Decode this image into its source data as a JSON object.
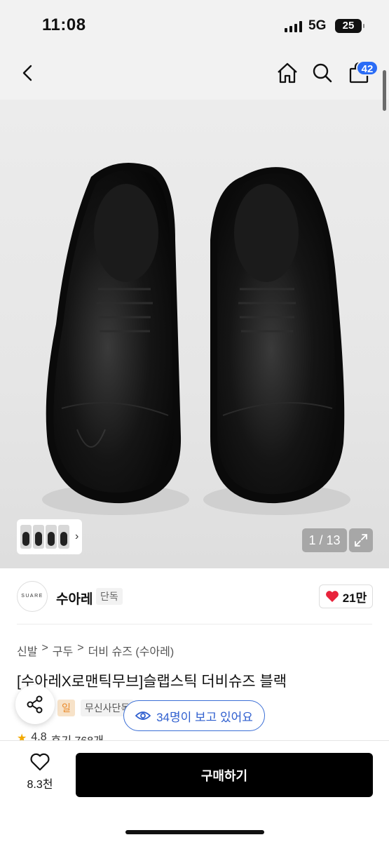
{
  "status_bar": {
    "time": "11:08",
    "network": "5G",
    "battery": "25",
    "icons": [
      "signal-icon",
      "battery-icon"
    ]
  },
  "nav": {
    "icons": [
      "back-icon",
      "home-icon",
      "search-icon",
      "cart-icon"
    ],
    "cart_badge": "42"
  },
  "gallery": {
    "counter": "1 / 13",
    "thumb_arrow": "›",
    "icons": [
      "expand-icon",
      "chevron-right-icon"
    ]
  },
  "brand": {
    "logo_text": "SUARE",
    "name": "수아레",
    "tag": "단독",
    "likes": "21만",
    "icons": [
      "heart-icon"
    ]
  },
  "breadcrumb": {
    "items": [
      "신발",
      "구두",
      "더비 슈즈 (수아레)"
    ],
    "separator": ">"
  },
  "product": {
    "title": "[수아레X로맨틱무브]슬랩스틱 더비슈즈 블랙",
    "badge_partial": "일",
    "badge_exclusive": "무신사단독",
    "rating": "4.8",
    "reviews": "후기 768개"
  },
  "floating": {
    "viewers": "34명이 보고 있어요",
    "icons": [
      "share-icon",
      "eye-icon"
    ]
  },
  "bottom_bar": {
    "wish_count": "8.3천",
    "buy_label": "구매하기",
    "icons": [
      "heart-outline-icon"
    ]
  },
  "colors": {
    "accent_blue": "#2a6cf6",
    "like_red": "#e8233b",
    "buy_black": "#000000"
  }
}
